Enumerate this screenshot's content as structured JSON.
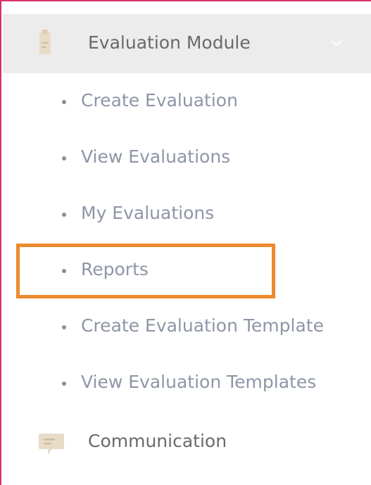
{
  "module": {
    "title": "Evaluation Module",
    "icon": "clipboard-icon",
    "expand_icon": "chevron-down-icon"
  },
  "menu": {
    "items": [
      {
        "label": "Create Evaluation"
      },
      {
        "label": "View Evaluations"
      },
      {
        "label": "My Evaluations"
      },
      {
        "label": "Reports",
        "highlighted": true
      },
      {
        "label": "Create Evaluation Template"
      },
      {
        "label": "View Evaluation Templates"
      }
    ]
  },
  "communication": {
    "label": "Communication",
    "icon": "chat-bubble-icon"
  },
  "colors": {
    "header_bg": "#ececec",
    "highlight_border": "#ed8a2e",
    "frame_border": "#d6336c",
    "item_text": "#8e96a6",
    "header_text": "#6a6a6a",
    "icon_tint": "#e8dcc8"
  }
}
